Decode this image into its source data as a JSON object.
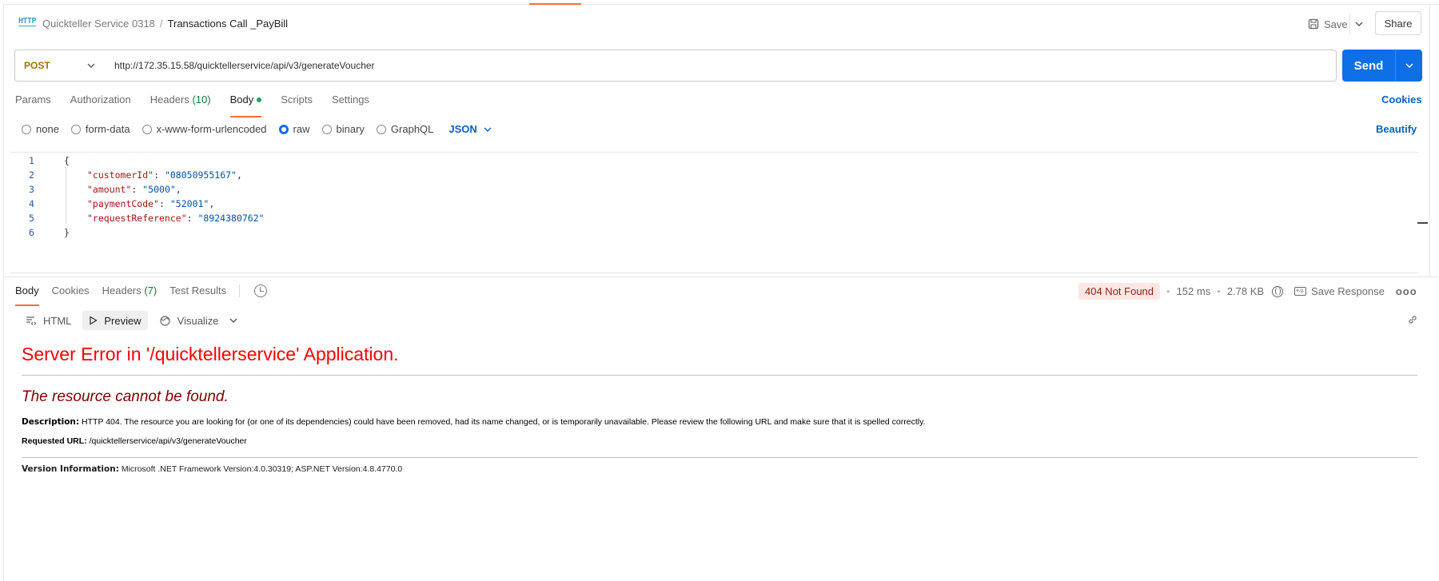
{
  "header": {
    "collection": "Quickteller Service 0318",
    "separator": "/",
    "request_name": "Transactions Call _PayBill",
    "save_label": "Save",
    "share_label": "Share"
  },
  "request": {
    "method": "POST",
    "url": "http://172.35.15.58/quicktellerservice/api/v3/generateVoucher",
    "send_label": "Send"
  },
  "request_tabs": {
    "params": "Params",
    "authorization": "Authorization",
    "headers": "Headers",
    "headers_count": "(10)",
    "body": "Body",
    "scripts": "Scripts",
    "settings": "Settings",
    "cookies": "Cookies"
  },
  "body_types": {
    "none": "none",
    "form_data": "form-data",
    "urlencoded": "x-www-form-urlencoded",
    "raw": "raw",
    "binary": "binary",
    "graphql": "GraphQL",
    "format": "JSON",
    "beautify": "Beautify",
    "selected": "raw"
  },
  "code": {
    "lines": [
      "1",
      "2",
      "3",
      "4",
      "5",
      "6"
    ],
    "open": "{",
    "close": "}",
    "fields": [
      {
        "key": "\"customerId\"",
        "value": "\"08050955167\"",
        "trail": ","
      },
      {
        "key": "\"amount\"",
        "value": "\"5000\"",
        "trail": ","
      },
      {
        "key": "\"paymentCode\"",
        "value": "\"52001\"",
        "trail": ","
      },
      {
        "key": "\"requestReference\"",
        "value": "\"8924380762\"",
        "trail": ""
      }
    ]
  },
  "response_tabs": {
    "body": "Body",
    "cookies": "Cookies",
    "headers": "Headers",
    "headers_count": "(7)",
    "test_results": "Test Results"
  },
  "response_meta": {
    "status": "404 Not Found",
    "time": "152 ms",
    "size": "2.78 KB",
    "save_response": "Save Response",
    "more": "ooo"
  },
  "preview_toolbar": {
    "html": "HTML",
    "preview": "Preview",
    "visualize": "Visualize"
  },
  "rendered": {
    "title": "Server Error in '/quicktellerservice' Application.",
    "subtitle": "The resource cannot be found.",
    "description_label": "Description:",
    "description": "HTTP 404. The resource you are looking for (or one of its dependencies) could have been removed, had its name changed, or is temporarily unavailable.  Please review the following URL and make sure that it is spelled correctly.",
    "requested_url_label": "Requested URL:",
    "requested_url": "/quicktellerservice/api/v3/generateVoucher",
    "version_label": "Version Information:",
    "version": "Microsoft .NET Framework Version:4.0.30319; ASP.NET Version:4.8.4770.0"
  }
}
